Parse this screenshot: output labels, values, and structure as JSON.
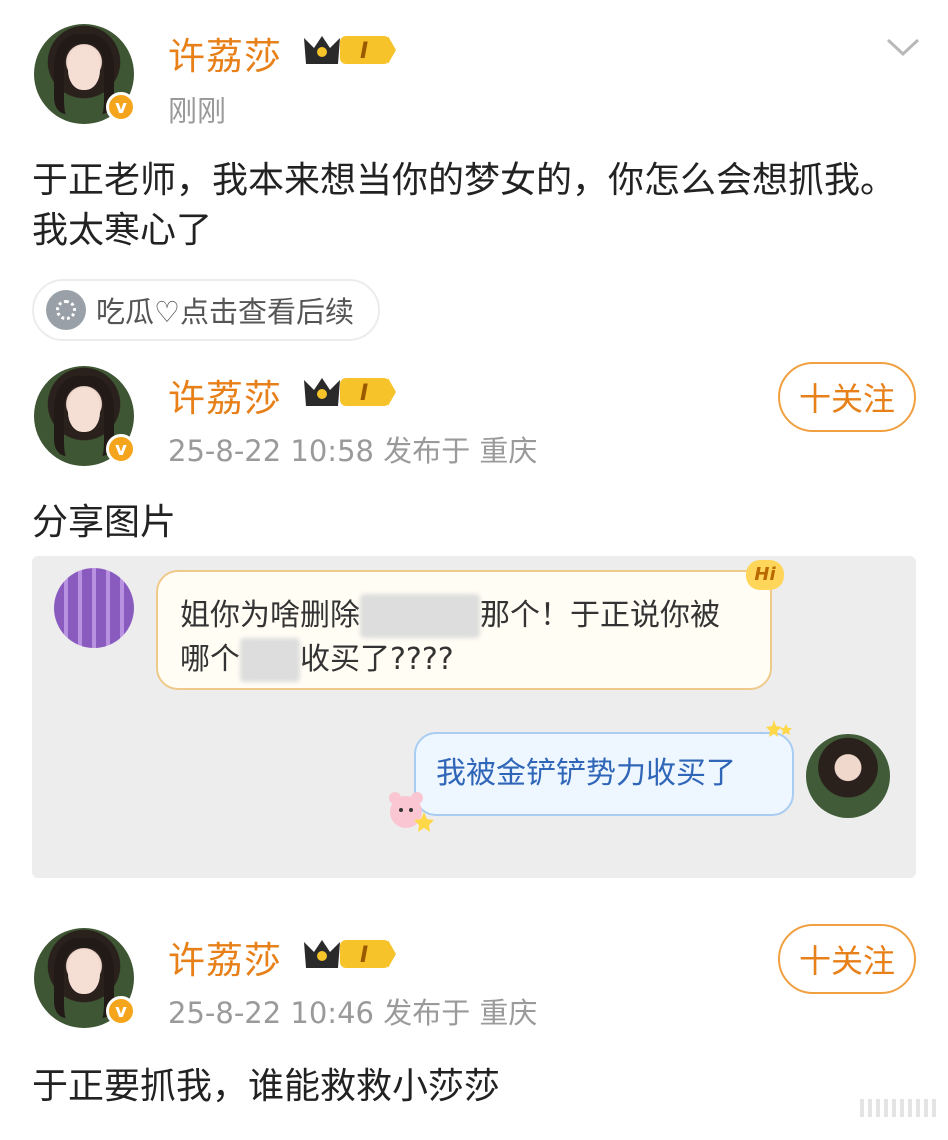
{
  "posts": [
    {
      "author": "许荔莎",
      "time": "刚刚",
      "body": "于正老师，我本来想当你的梦女的，你怎么会想抓我。我太寒心了",
      "chip": "吃瓜♡点击查看后续"
    },
    {
      "author": "许荔莎",
      "time": "25-8-22 10:58  发布于 重庆",
      "follow": "十关注",
      "body": "分享图片",
      "chat": {
        "left_msg_a": "姐你为啥删除",
        "left_msg_b": "那个！于正说你被",
        "left_msg_c": "哪个",
        "left_msg_d": "收买了????",
        "left_badge": "Hi",
        "right_msg": "我被金铲铲势力收买了"
      }
    },
    {
      "author": "许荔莎",
      "time": "25-8-22 10:46  发布于 重庆",
      "follow": "十关注",
      "body": "于正要抓我，谁能救救小莎莎"
    }
  ],
  "verified_mark": "v",
  "level": "I",
  "colors": {
    "name": "#e8801a",
    "meta": "#9a9a9a",
    "accent": "#f4a51c"
  },
  "icons": [
    "chevron-down-icon",
    "verified-icon",
    "crown-icon",
    "melon-icon"
  ]
}
